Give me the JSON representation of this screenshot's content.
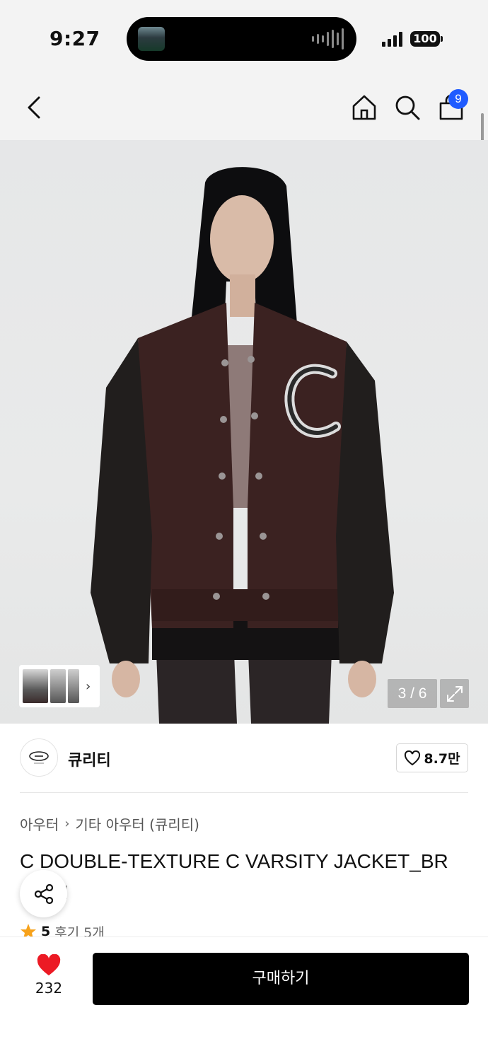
{
  "status_bar": {
    "time": "9:27",
    "battery": "100"
  },
  "nav": {
    "cart_count": "9",
    "icons": [
      "back-icon",
      "home-icon",
      "search-icon",
      "cart-icon"
    ]
  },
  "gallery": {
    "counter": "3 / 6",
    "thumb_chevron": "›"
  },
  "brand": {
    "name": "큐리티",
    "likes": "8.7만"
  },
  "product": {
    "breadcrumb": [
      "아우터",
      "기타 아우터 (큐리티)"
    ],
    "breadcrumb_sep": "›",
    "title_line1": "C DOUBLE-TEXTURE C VARSITY JACKET_BR",
    "title_line2": "OWN",
    "rating": "5",
    "reviews": "후기 5개"
  },
  "bottom_bar": {
    "like_count": "232",
    "buy_label": "구매하기"
  },
  "colors": {
    "accent_blue": "#1f5bff",
    "heart_red": "#ec1a24",
    "star_orange": "#f7a21b",
    "button_black": "#000000"
  }
}
